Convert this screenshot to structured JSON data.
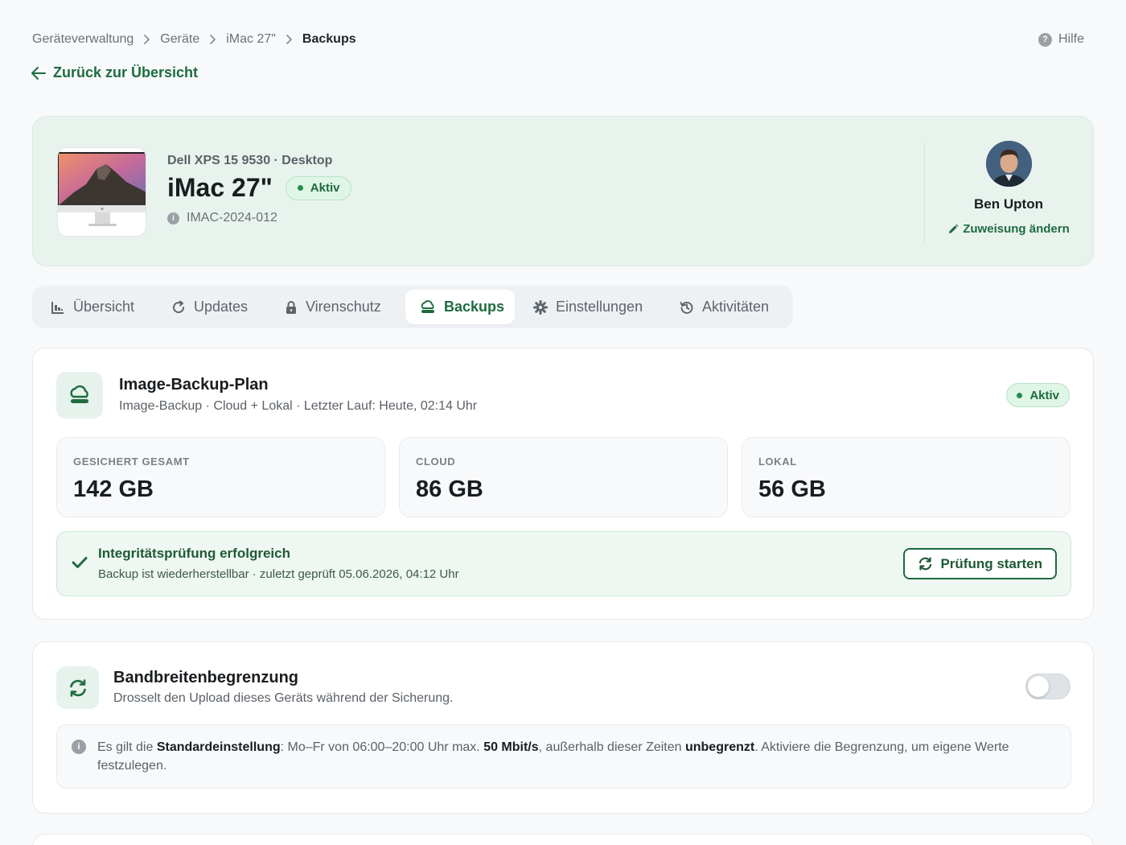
{
  "breadcrumb": [
    "Geräteverwaltung",
    "Geräte",
    "iMac 27\"",
    "Backups"
  ],
  "help_label": "Hilfe",
  "back_label": "Zurück zur Übersicht",
  "device": {
    "subtitle": "Dell XPS 15 9530 · Desktop",
    "name": "iMac 27\"",
    "status": "Aktiv",
    "asset_id": "IMAC-2024-012"
  },
  "assignee": {
    "name": "Ben Upton",
    "reassign_label": "Zuweisung ändern"
  },
  "tabs": [
    {
      "label": "Übersicht",
      "icon": "chart-icon",
      "active": false
    },
    {
      "label": "Updates",
      "icon": "refresh-icon",
      "active": false
    },
    {
      "label": "Virenschutz",
      "icon": "lock-icon",
      "active": false
    },
    {
      "label": "Backups",
      "icon": "cloud-icon",
      "active": true
    },
    {
      "label": "Einstellungen",
      "icon": "gear-icon",
      "active": false
    },
    {
      "label": "Aktivitäten",
      "icon": "history-icon",
      "active": false
    }
  ],
  "backup_plan": {
    "title": "Image-Backup-Plan",
    "description": "Image-Backup · Cloud + Lokal · Letzter Lauf: Heute, 02:14 Uhr",
    "status": "Aktiv",
    "stats": [
      {
        "label": "GESICHERT GESAMT",
        "value": "142 GB"
      },
      {
        "label": "CLOUD",
        "value": "86 GB"
      },
      {
        "label": "LOKAL",
        "value": "56 GB"
      }
    ],
    "integrity": {
      "title": "Integritätsprüfung erfolgreich",
      "detail": "Backup ist wiederherstellbar · zuletzt geprüft 05.06.2026, 04:12 Uhr",
      "button_label": "Prüfung starten"
    }
  },
  "bandwidth": {
    "title": "Bandbreitenbegrenzung",
    "description": "Drosselt den Upload dieses Geräts während der Sicherung.",
    "enabled": false,
    "note": {
      "part1": "Es gilt die ",
      "bold1": "Standardeinstellung",
      "part2": ": Mo–Fr von 06:00–20:00 Uhr max. ",
      "bold2": "50 Mbit/s",
      "part3": ", außerhalb dieser Zeiten ",
      "bold3": "unbegrenzt",
      "part4": ". Aktiviere die Begrenzung, um eigene Werte festzulegen."
    }
  },
  "colors": {
    "accent": "#1e6b3f",
    "status_green": "#1f8f4e",
    "hero_bg": "#e9f3ee"
  }
}
